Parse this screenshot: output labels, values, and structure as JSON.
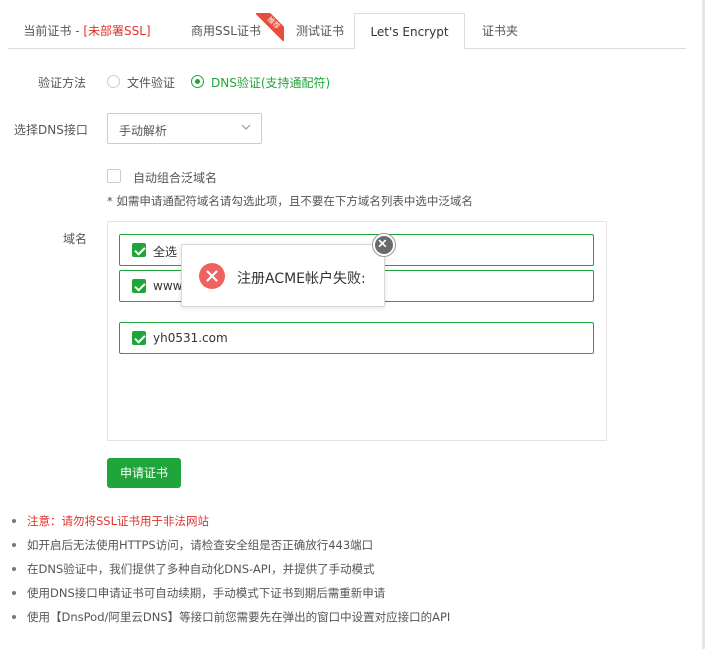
{
  "tabs": [
    {
      "label": "当前证书",
      "suffix": " - [未部署SSL]",
      "active": false
    },
    {
      "label": "商用SSL证书",
      "badge": "推荐",
      "active": false
    },
    {
      "label": "测试证书",
      "active": false
    },
    {
      "label": "Let's Encrypt",
      "active": true
    },
    {
      "label": "证书夹",
      "active": false
    }
  ],
  "verify": {
    "label": "验证方法",
    "options": [
      "文件验证",
      "DNS验证(支持通配符)"
    ],
    "selected": "DNS验证(支持通配符)"
  },
  "dns": {
    "label": "选择DNS接口",
    "value": "手动解析"
  },
  "wildcard": {
    "label": "自动组合泛域名",
    "checked": false,
    "hint": "* 如需申请通配符域名请勾选此项，且不要在下方域名列表中选中泛域名"
  },
  "domains": {
    "label": "域名",
    "items": [
      {
        "text": "全选",
        "checked": true
      },
      {
        "text": "www",
        "checked": true
      },
      {
        "text": "yh0531.com",
        "checked": true
      }
    ]
  },
  "apply_button": "申请证书",
  "notes": [
    "注意：请勿将SSL证书用于非法网站",
    "如开启后无法使用HTTPS访问，请检查安全组是否正确放行443端口",
    "在DNS验证中，我们提供了多种自动化DNS-API，并提供了手动模式",
    "使用DNS接口申请证书可自动续期，手动模式下证书到期后需重新申请",
    "使用【DnsPod/阿里云DNS】等接口前您需要先在弹出的窗口中设置对应接口的API"
  ],
  "dialog": {
    "message": "注册ACME帐户失败:",
    "icon": "error-icon"
  },
  "colors": {
    "accent": "#20a53a",
    "warning": "#e0322b",
    "error_icon": "#f0625f"
  }
}
